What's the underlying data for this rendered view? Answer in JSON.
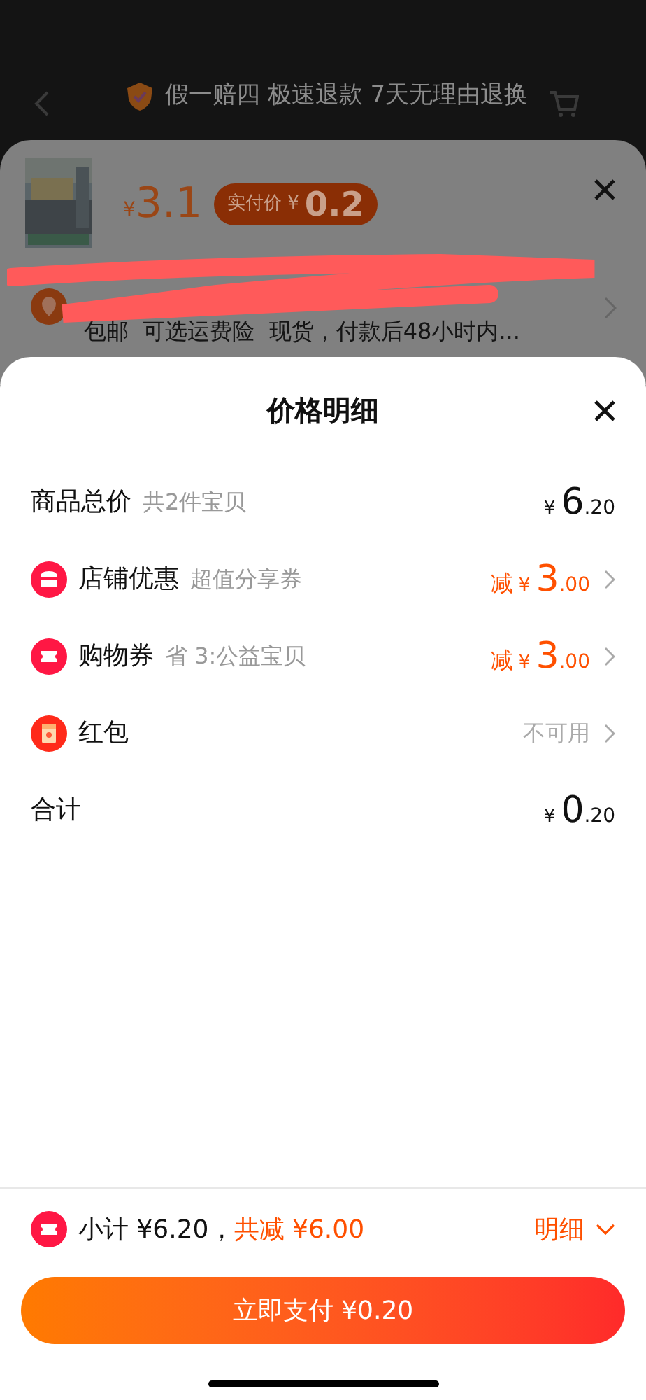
{
  "background": {
    "guarantee_banner": "假一赔四 极速退款 7天无理由退换"
  },
  "product_sheet": {
    "price_symbol": "¥",
    "price": "3.1",
    "pay_label": "实付价",
    "pay_symbol": "¥",
    "pay_amount": "0.2",
    "delivery_note": "包邮  可选运费险  现货，付款后48小时内..."
  },
  "price_detail": {
    "title": "价格明细",
    "rows": [
      {
        "kind": "sum",
        "label": "商品总价",
        "note": "共2件宝贝",
        "symbol": "¥",
        "amount": "6",
        "cents": ".20",
        "arrow": false
      },
      {
        "kind": "shop",
        "label": "店铺优惠",
        "note": "超值分享券",
        "prefix": "减",
        "symbol": "¥",
        "amount": "3",
        "cents": ".00",
        "arrow": true
      },
      {
        "kind": "coupon",
        "label": "购物券",
        "note": "省 3:公益宝贝",
        "prefix": "减",
        "symbol": "¥",
        "amount": "3",
        "cents": ".00",
        "arrow": true
      },
      {
        "kind": "packet",
        "label": "红包",
        "status": "不可用",
        "arrow": true
      },
      {
        "kind": "sum",
        "label": "合计",
        "symbol": "¥",
        "amount": "0",
        "cents": ".20",
        "arrow": false
      }
    ]
  },
  "summary": {
    "subtotal": "小计 ¥6.20，",
    "discount": "共减 ¥6.00",
    "detail_link": "明细"
  },
  "pay_button": "立即支付 ¥0.20"
}
